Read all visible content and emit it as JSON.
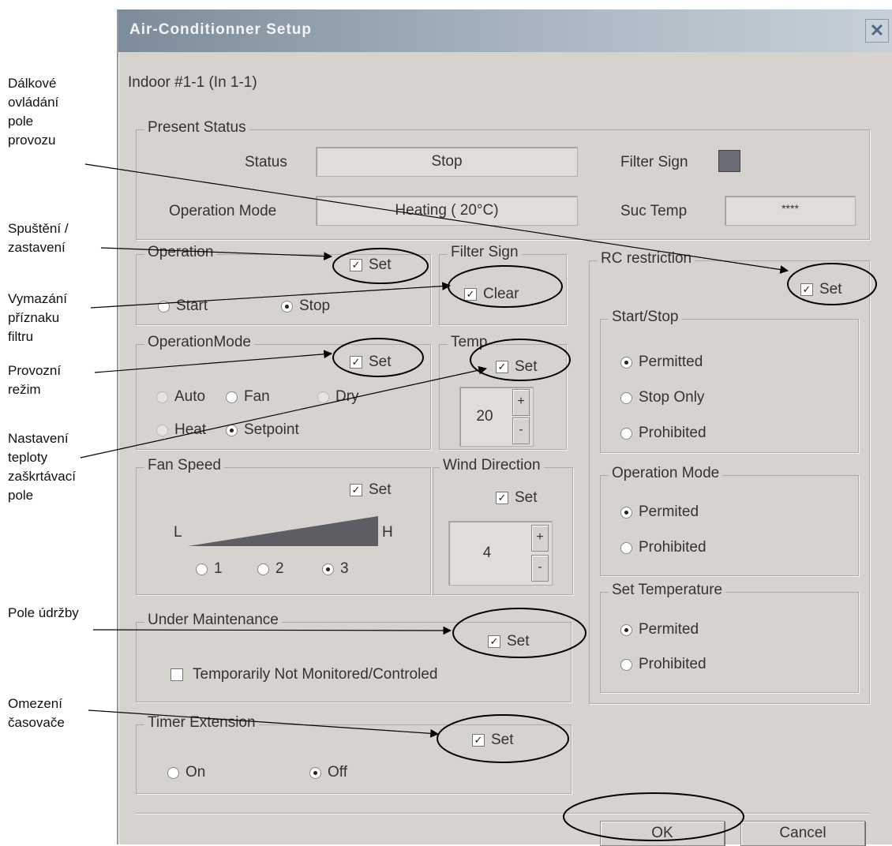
{
  "annotations": {
    "remote_control": "Dálkové\novládání\npole\nprovozu",
    "start_stop": "Spuštění /\nzastavení",
    "filter_clear": "Vymazání\npříznaku\nfiltru",
    "operation_mode": "Provozní\nrežim",
    "temp_setting": "Nastavení\nteploty\nzaškrtávací\npole",
    "maintenance": "Pole údržby",
    "timer_limit": "Omezení\nčasovače"
  },
  "window": {
    "title": "Air-Conditionner Setup",
    "close_glyph": "✕"
  },
  "unit_label": "Indoor #1-1  (In 1-1)",
  "present_status": {
    "legend": "Present Status",
    "status_label": "Status",
    "status_value": "Stop",
    "filter_sign_label": "Filter Sign",
    "operation_mode_label": "Operation Mode",
    "operation_mode_value": "Heating  ( 20°C)",
    "suc_temp_label": "Suc Temp",
    "suc_temp_value": "****"
  },
  "operation": {
    "legend": "Operation",
    "set_label": "Set",
    "set_checked": true,
    "start_label": "Start",
    "stop_label": "Stop",
    "selected": "Stop"
  },
  "filter_sign": {
    "legend": "Filter Sign",
    "clear_label": "Clear",
    "clear_checked": true
  },
  "operation_mode": {
    "legend": "OperationMode",
    "set_label": "Set",
    "set_checked": true,
    "auto": "Auto",
    "fan": "Fan",
    "dry": "Dry",
    "heat": "Heat",
    "setpoint": "Setpoint",
    "selected": "Setpoint"
  },
  "temp": {
    "legend": "Temp",
    "set_label": "Set",
    "set_checked": true,
    "value": "20",
    "plus": "+",
    "minus": "-"
  },
  "fan_speed": {
    "legend": "Fan Speed",
    "set_label": "Set",
    "set_checked": true,
    "low": "L",
    "high": "H",
    "opt1": "1",
    "opt2": "2",
    "opt3": "3",
    "selected": "3"
  },
  "wind_direction": {
    "legend": "Wind Direction",
    "set_label": "Set",
    "set_checked": true,
    "value": "4",
    "plus": "+",
    "minus": "-"
  },
  "under_maintenance": {
    "legend": "Under Maintenance",
    "set_label": "Set",
    "set_checked": true,
    "temp_not_monitored": "Temporarily Not Monitored/Controled",
    "temp_not_monitored_checked": false
  },
  "timer_extension": {
    "legend": "Timer Extension",
    "set_label": "Set",
    "set_checked": true,
    "on": "On",
    "off": "Off",
    "selected": "Off"
  },
  "rc_restriction": {
    "legend": "RC restriction",
    "set_label": "Set",
    "set_checked": true,
    "start_stop": {
      "legend": "Start/Stop",
      "permitted": "Permitted",
      "stop_only": "Stop Only",
      "prohibited": "Prohibited",
      "selected": "Permitted"
    },
    "operation_mode": {
      "legend": "Operation Mode",
      "permitted": "Permited",
      "prohibited": "Prohibited",
      "selected": "Permited"
    },
    "set_temperature": {
      "legend": "Set Temperature",
      "permitted": "Permited",
      "prohibited": "Prohibited",
      "selected": "Permited"
    }
  },
  "buttons": {
    "ok": "OK",
    "cancel": "Cancel"
  },
  "colors": {
    "dialog_bg": "#d6d3ce",
    "filter_sign_indicator": "#6a6c74",
    "annotation_line": "#000000"
  }
}
